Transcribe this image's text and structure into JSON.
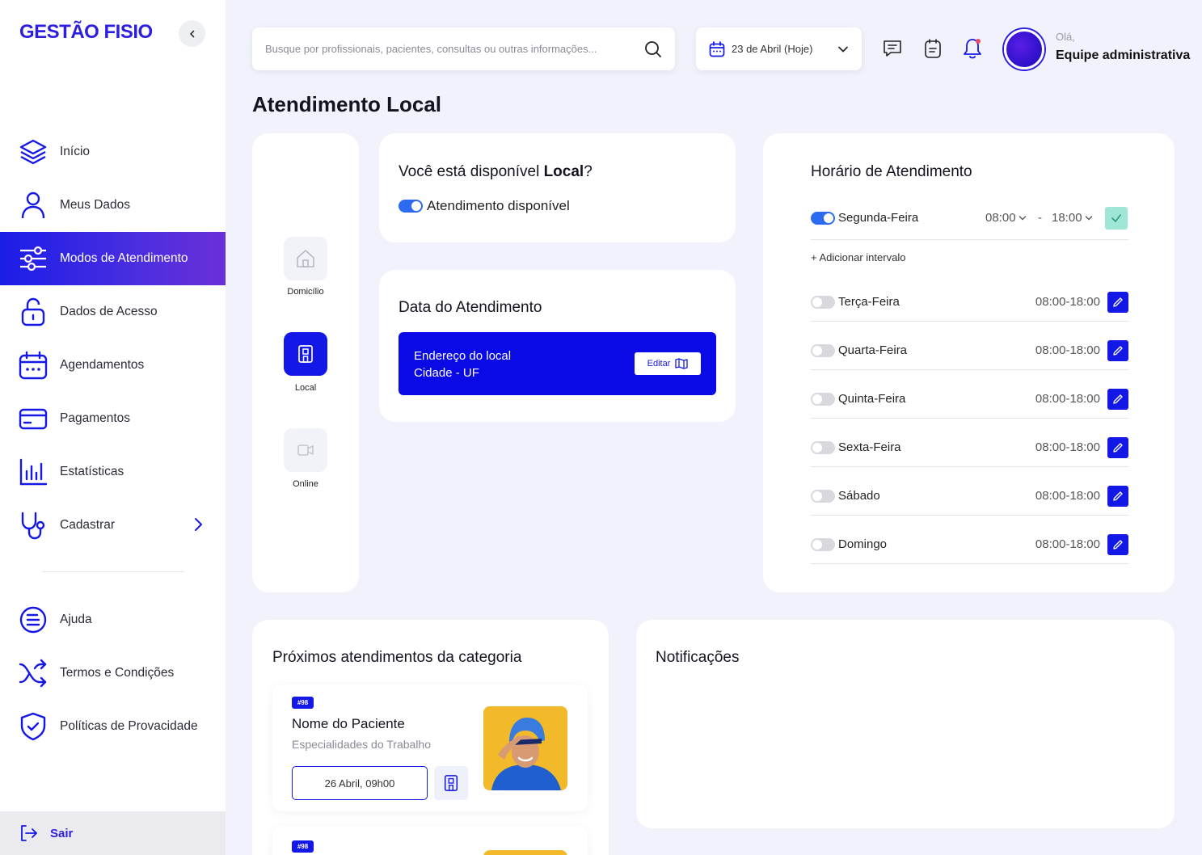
{
  "brand": {
    "logo": "GESTÃO FISIO",
    "primary": "#1418e6",
    "accent": "#6a2fd8"
  },
  "sidebar": {
    "items": [
      {
        "label": "Início",
        "icon": "layers-icon"
      },
      {
        "label": "Meus Dados",
        "icon": "user-icon"
      },
      {
        "label": "Modos de Atendimento",
        "icon": "sliders-icon",
        "active": true
      },
      {
        "label": "Dados de Acesso",
        "icon": "unlock-icon"
      },
      {
        "label": "Agendamentos",
        "icon": "calendar-icon"
      },
      {
        "label": "Pagamentos",
        "icon": "credit-card-icon"
      },
      {
        "label": "Estatísticas",
        "icon": "bar-chart-icon"
      },
      {
        "label": "Cadastrar",
        "icon": "stethoscope-icon"
      }
    ],
    "secondary": [
      {
        "label": "Ajuda",
        "icon": "help-doc-icon"
      },
      {
        "label": "Termos e Condições",
        "icon": "shuffle-icon"
      },
      {
        "label": "Políticas de Provacidade",
        "icon": "shield-check-icon"
      }
    ],
    "logout": "Sair"
  },
  "topbar": {
    "search_placeholder": "Busque por profissionais, pacientes, consultas ou outras informações...",
    "date": "23 de Abril (Hoje)",
    "greeting": "Olá,",
    "user": "Equipe administrativa"
  },
  "page": {
    "title": "Atendimento Local"
  },
  "modes": [
    {
      "label": "Domicílio",
      "active": false
    },
    {
      "label": "Local",
      "active": true
    },
    {
      "label": "Online",
      "active": false
    }
  ],
  "availability": {
    "title_prefix": "Você está disponível ",
    "title_mode": "Local",
    "title_suffix": "?",
    "toggle_label": "Atendimento disponível",
    "enabled": true
  },
  "date_card": {
    "title": "Data do Atendimento",
    "address_line1": "Endereço do local",
    "address_line2": "Cidade - UF",
    "edit_label": "Editar"
  },
  "schedule": {
    "title": "Horário de Atendimento",
    "first": {
      "day": "Segunda-Feira",
      "start": "08:00",
      "end": "18:00",
      "sep": "-",
      "enabled": true
    },
    "add_interval": "+ Adicionar intervalo",
    "days": [
      {
        "day": "Terça-Feira",
        "hours": "08:00-18:00",
        "enabled": false
      },
      {
        "day": "Quarta-Feira",
        "hours": "08:00-18:00",
        "enabled": false
      },
      {
        "day": "Quinta-Feira",
        "hours": "08:00-18:00",
        "enabled": false
      },
      {
        "day": "Sexta-Feira",
        "hours": "08:00-18:00",
        "enabled": false
      },
      {
        "day": "Sábado",
        "hours": "08:00-18:00",
        "enabled": false
      },
      {
        "day": "Domingo",
        "hours": "08:00-18:00",
        "enabled": false
      }
    ]
  },
  "upcoming": {
    "title": "Próximos atendimentos da categoria",
    "items": [
      {
        "badge": "#98",
        "patient": "Nome do Paciente",
        "specialty": "Especialidades do Trabalho",
        "datetime": "26 Abril, 09h00"
      },
      {
        "badge": "#98"
      }
    ]
  },
  "notifications": {
    "title": "Notificações"
  }
}
